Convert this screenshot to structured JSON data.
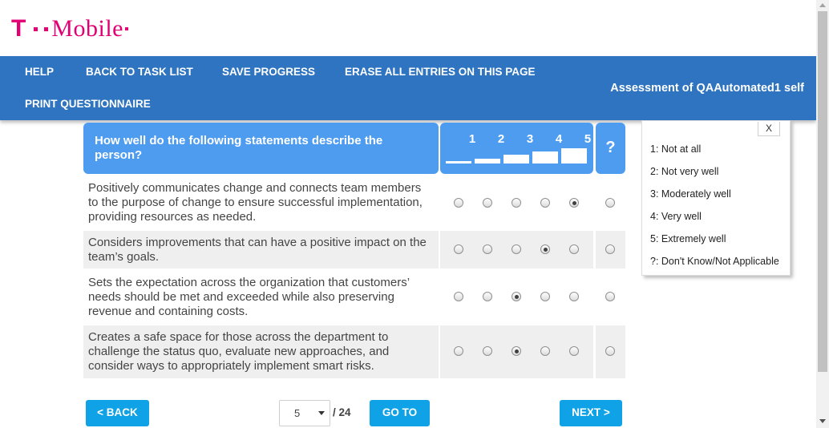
{
  "brand": {
    "logo_t": "T",
    "logo_word": "Mobile",
    "color": "#e20074"
  },
  "nav": {
    "help": "HELP",
    "back_to_task_list": "BACK TO TASK LIST",
    "save_progress": "SAVE PROGRESS",
    "erase_all": "ERASE ALL ENTRIES ON THIS PAGE",
    "print_questionnaire": "PRINT QUESTIONNAIRE",
    "assessment_title": "Assessment of QAAutomated1 self",
    "bar_color": "#2f74c0"
  },
  "question": {
    "prompt": "How well do the following statements describe the person?",
    "scale": [
      "1",
      "2",
      "3",
      "4",
      "5"
    ],
    "dont_know_label": "?",
    "header_color": "#4e9cf0"
  },
  "rows": [
    {
      "text": "Positively communicates change and connects team members to the purpose of change to ensure successful implementation, providing resources as needed.",
      "selected": "5"
    },
    {
      "text": "Considers improvements that can have a positive impact on the team’s goals.",
      "selected": "4"
    },
    {
      "text": "Sets the expectation across the organization that customers’ needs should be met and exceeded while also preserving revenue and containing costs.",
      "selected": "3"
    },
    {
      "text": "Creates a safe space for those across the department to challenge the status quo, evaluate new approaches, and consider ways to appropriately implement smart risks.",
      "selected": "3"
    }
  ],
  "legend": {
    "close": "X",
    "items": [
      "1: Not at all",
      "2: Not very well",
      "3: Moderately well",
      "4: Very well",
      "5: Extremely well",
      "?: Don't Know/Not Applicable"
    ]
  },
  "footer": {
    "back": "< BACK",
    "page_selected": "5",
    "page_total": "/ 24",
    "goto": "GO TO",
    "next": "NEXT >",
    "button_color": "#0fa2e6"
  }
}
